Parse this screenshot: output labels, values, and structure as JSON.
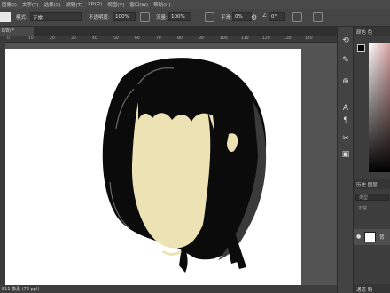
{
  "menu": [
    "图像(I)",
    "文字(Y)",
    "选择(S)",
    "滤镜(T)",
    "3D(D)",
    "视图(V)",
    "窗口(W)",
    "帮助(H)"
  ],
  "options": {
    "mode_label": "模式:",
    "mode_value": "正常",
    "opacity_label": "不透明度:",
    "opacity_value": "100%",
    "flow_label": "流量:",
    "flow_value": "100%",
    "smooth_label": "平滑:",
    "smooth_value": "0%",
    "angle_value": "0°"
  },
  "document": {
    "tab_label": "8/8) *",
    "ruler_ticks": [
      "0",
      "10",
      "20",
      "30",
      "40",
      "50",
      "60",
      "70",
      "80",
      "90",
      "100",
      "110",
      "120",
      "130",
      "140"
    ],
    "status": "811 像素 (72 ppi)"
  },
  "panels": {
    "color_tabs": "颜色  色",
    "layer_tabs": "历史  图层",
    "layer_search": "类型",
    "layer_mode": "正常",
    "layer_name": "背",
    "bottom_tabs": "通道  路"
  },
  "colors": {
    "hair": "#0a0a0a",
    "face": "#ece2b4",
    "canvas": "#ffffff",
    "workspace": "#535353"
  }
}
